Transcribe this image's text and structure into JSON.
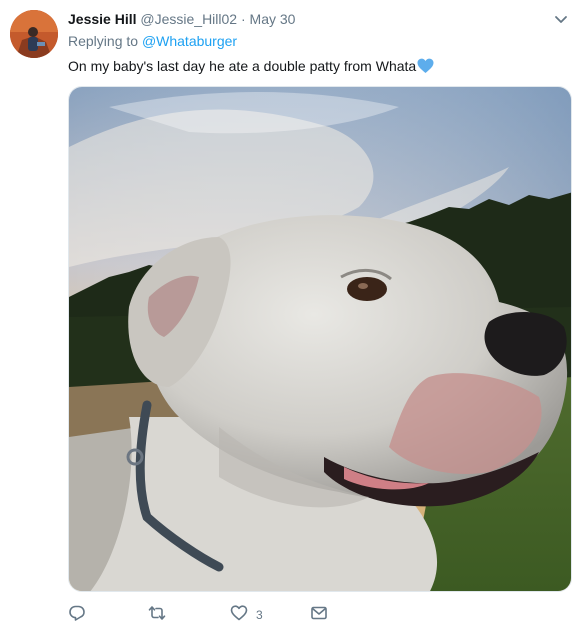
{
  "tweet": {
    "name": "Jessie Hill",
    "handle": "@Jessie_Hill02",
    "separator": "·",
    "date": "May 30",
    "replying_prefix": "Replying to",
    "replying_to": "@Whataburger",
    "text": "On my baby's last day he ate a double patty from Whata",
    "emoji": "blue-heart-icon",
    "photo_description_icon": "dog-photo",
    "likes": "3"
  },
  "icons": {
    "reply": "reply-icon",
    "retweet": "retweet-icon",
    "like": "heart-icon",
    "dm": "envelope-icon",
    "more": "chevron-down-icon"
  },
  "colors": {
    "accent": "#1da1f2",
    "secondary_text": "#657786",
    "heart_emoji": "#5dadec"
  }
}
